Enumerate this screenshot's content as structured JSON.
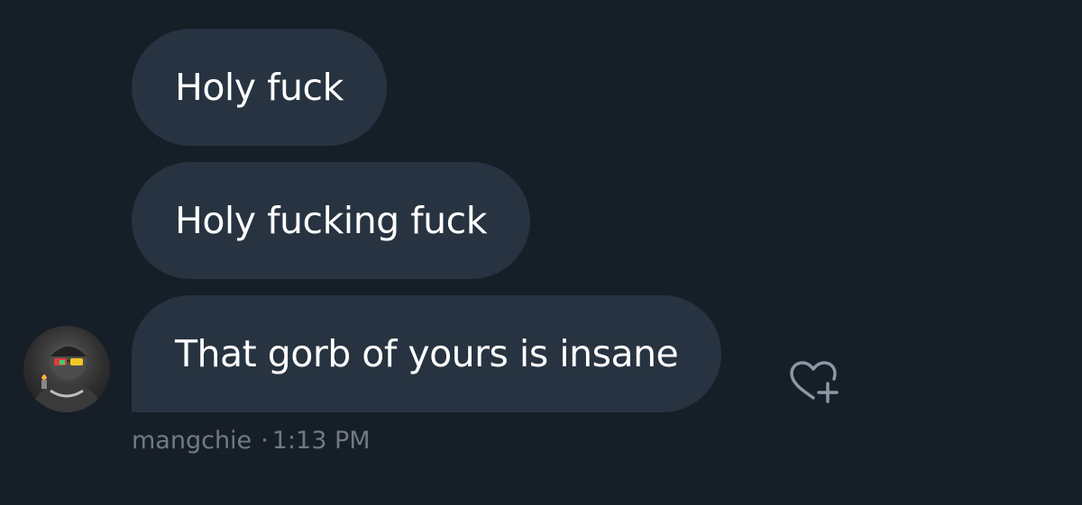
{
  "messages": [
    {
      "text": "Holy fuck"
    },
    {
      "text": "Holy fucking fuck"
    },
    {
      "text": "That gorb of yours is insane"
    }
  ],
  "sender": {
    "username": "mangchie",
    "time": "1:13 PM",
    "avatar_icon": "user-avatar-sunglasses"
  },
  "react_icon": "heart-plus-icon",
  "colors": {
    "background": "#161e28",
    "bubble": "#273340",
    "text": "#ffffff",
    "meta": "#717a84",
    "icon": "#8b98a5"
  }
}
